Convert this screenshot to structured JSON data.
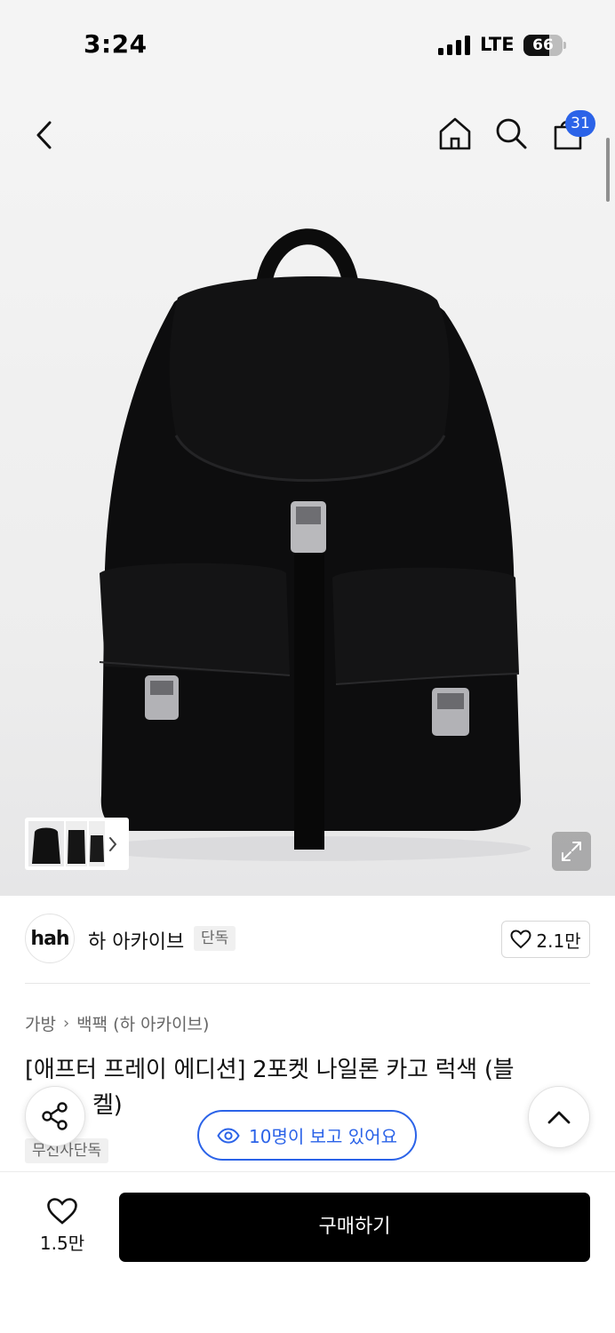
{
  "status": {
    "time": "3:24",
    "network": "LTE",
    "battery": "66",
    "battery_level": 0.66
  },
  "header": {
    "icons": [
      "back-icon",
      "home-icon",
      "search-icon",
      "cart-icon"
    ],
    "cart_count": "31"
  },
  "hero": {
    "thumbnail_more_icon": "chevron-right-icon",
    "expand_icon": "expand-icon"
  },
  "brand": {
    "logo_text": "hah",
    "name": "하 아카이브",
    "tag": "단독",
    "like_count": "2.1만"
  },
  "breadcrumb": {
    "category": "가방",
    "subcategory": "백팩 (하 아카이브)"
  },
  "product": {
    "title_visible": "[애프터 프레이 에디션] 2포켓 나일론 카고 럭색 (블",
    "title_line2_visible": "켈)",
    "exclusive_tag": "무신사단독"
  },
  "floating": {
    "viewers_text": "10명이 보고 있어요",
    "share_icon": "share-icon",
    "top_icon": "chevron-up-icon"
  },
  "bottom": {
    "wish_count": "1.5만",
    "buy_label": "구매하기"
  },
  "colors": {
    "accent": "#2b63e8",
    "buy_button": "#000000",
    "background": "#ffffff"
  }
}
